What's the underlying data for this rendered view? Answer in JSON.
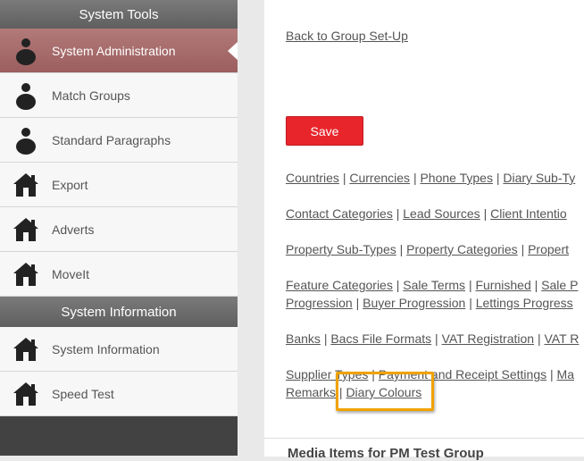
{
  "sidebar": {
    "section1_title": "System Tools",
    "section2_title": "System Information",
    "items1": [
      {
        "label": "System Administration",
        "icon": "person-icon"
      },
      {
        "label": "Match Groups",
        "icon": "person-icon"
      },
      {
        "label": "Standard Paragraphs",
        "icon": "person-icon"
      },
      {
        "label": "Export",
        "icon": "house-icon"
      },
      {
        "label": "Adverts",
        "icon": "house-icon"
      },
      {
        "label": "MoveIt",
        "icon": "house-icon"
      }
    ],
    "items2": [
      {
        "label": "System Information",
        "icon": "house-icon"
      },
      {
        "label": "Speed Test",
        "icon": "house-icon"
      }
    ]
  },
  "main": {
    "back_link": "Back to Group Set-Up",
    "save_label": "Save",
    "links": {
      "row1": [
        "Countries",
        "Currencies",
        "Phone Types",
        "Diary Sub-Ty"
      ],
      "row2": [
        "Contact Categories",
        "Lead Sources",
        "Client Intentio"
      ],
      "row3": [
        "Property Sub-Types",
        "Property Categories",
        "Propert"
      ],
      "row4": [
        "Feature Categories",
        "Sale Terms",
        "Furnished",
        "Sale P"
      ],
      "row5": [
        "Progression",
        "Buyer Progression",
        "Lettings Progress"
      ],
      "row6": [
        "Banks",
        "Bacs File Formats",
        "VAT Registration",
        "VAT R"
      ],
      "row7": [
        "Supplier Types",
        "Payment and Receipt Settings",
        "Ma"
      ],
      "row8": [
        "Remarks",
        "Diary Colours"
      ]
    },
    "separator": "|",
    "bottom_title": "Media Items for PM Test Group"
  },
  "colors": {
    "save_bg": "#e8252b",
    "active_item": "#a86868",
    "highlight": "#f0a200"
  }
}
